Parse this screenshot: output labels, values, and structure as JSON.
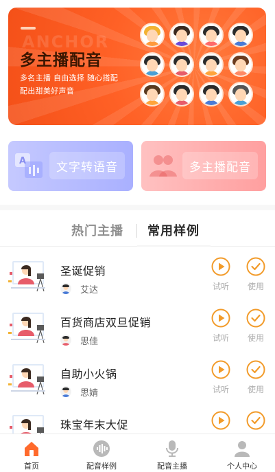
{
  "banner": {
    "ghost_text": "ANCHOR",
    "title": "多主播配音",
    "subtitle_line1": "多名主播  自由选择  随心搭配",
    "subtitle_line2": "配出甜美好声音",
    "background_color": "#ff6126",
    "face_count": 12
  },
  "features": {
    "tts_label": "文字转语音",
    "multi_label": "多主播配音"
  },
  "tabs": {
    "hot": "热门主播",
    "common": "常用样例",
    "active": "常用样例"
  },
  "list": {
    "play_label": "试听",
    "use_label": "使用",
    "accent_color": "#f29b2a",
    "items": [
      {
        "title": "圣诞促销",
        "speaker": "艾达"
      },
      {
        "title": "百货商店双旦促销",
        "speaker": "思佳"
      },
      {
        "title": "自助小火锅",
        "speaker": "思婧"
      },
      {
        "title": "珠宝年末大促",
        "speaker": ""
      }
    ]
  },
  "nav": {
    "items": [
      {
        "label": "首页",
        "icon": "home-icon",
        "active": true
      },
      {
        "label": "配音样例",
        "icon": "waveform-icon",
        "active": false
      },
      {
        "label": "配音主播",
        "icon": "microphone-icon",
        "active": false
      },
      {
        "label": "个人中心",
        "icon": "user-icon",
        "active": false
      }
    ],
    "active_color": "#ff6a2c"
  }
}
